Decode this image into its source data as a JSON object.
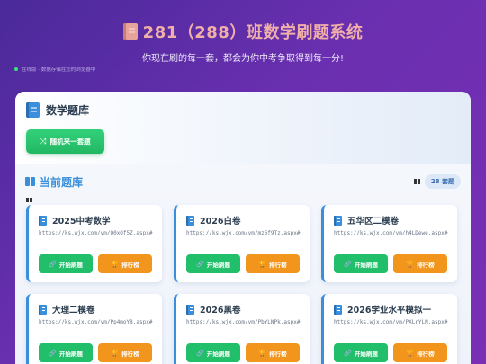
{
  "header": {
    "title": "281（288）班数学刷题系统",
    "subtitle": "你现在刷的每一套，都会为你中考争取得到每一分!"
  },
  "status": {
    "text": "在线版 · 数据存储在您的浏览器中"
  },
  "panel": {
    "title": "数学题库",
    "random_button": "随机来一套题"
  },
  "current": {
    "title": "当前题库",
    "count": "28 套题"
  },
  "cards": [
    {
      "title": "2025中考数学",
      "url": "https://ks.wjx.com/vm/O0xQf5Z.aspx#",
      "start": "开始刷题",
      "rank": "排行榜"
    },
    {
      "title": "2026白卷",
      "url": "https://ks.wjx.com/vm/mz6f9Tz.aspx#",
      "start": "开始刷题",
      "rank": "排行榜"
    },
    {
      "title": "五华区二模卷",
      "url": "https://ks.wjx.com/vm/h4LDewe.aspx#",
      "start": "开始刷题",
      "rank": "排行榜"
    },
    {
      "title": "大理二模卷",
      "url": "https://ks.wjx.com/vm/Pp4moY8.aspx#",
      "start": "开始刷题",
      "rank": "排行榜"
    },
    {
      "title": "2026黑卷",
      "url": "https://ks.wjx.com/vm/PbYLNPk.aspx#",
      "start": "开始刷题",
      "rank": "排行榜"
    },
    {
      "title": "2026学业水平模拟一",
      "url": "https://ks.wjx.com/vm/PXLrYLN.aspx#",
      "start": "开始刷题",
      "rank": "排行榜"
    }
  ],
  "colors": {
    "accent": "#3a8fdc",
    "start_button": "#22bf6a",
    "rank_button": "#f1951c",
    "title_color": "#f0b0a8"
  }
}
